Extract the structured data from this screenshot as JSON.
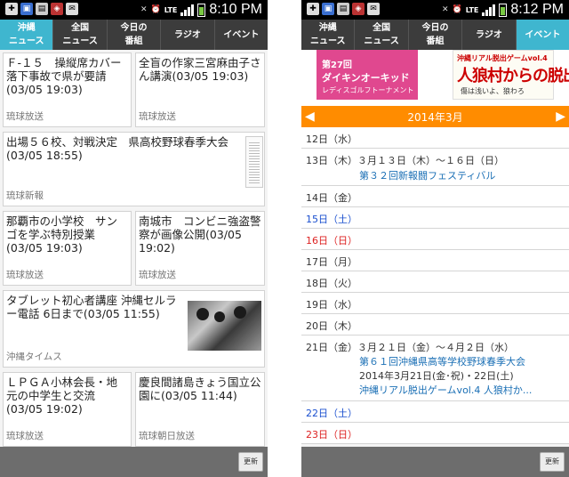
{
  "left": {
    "status": {
      "clock": "8:10 PM",
      "network": "LTE"
    },
    "tabs": [
      "沖縄\nニュース",
      "全国\nニュース",
      "今日の\n番組",
      "ラジオ",
      "イベント"
    ],
    "active_tab": 0,
    "articles": [
      {
        "title": "Ｆ-１５　操縦席カバー落下事故で県が要請(03/05 19:03)",
        "source": "琉球放送"
      },
      {
        "title": "全盲の作家三宮麻由子さん講演(03/05 19:03)",
        "source": "琉球放送"
      },
      {
        "title": "出場５６校、対戦決定　県高校野球春季大会(03/05 18:55)",
        "source": "琉球新報"
      },
      {
        "title": "那覇市の小学校　サンゴを学ぶ特別授業(03/05 19:03)",
        "source": "琉球放送"
      },
      {
        "title": "南城市　コンビニ強盗警察が画像公開(03/05 19:02)",
        "source": "琉球放送"
      },
      {
        "title": "タブレット初心者講座 沖縄セルラー電話 6日まで(03/05 11:55)",
        "source": "沖縄タイムス"
      },
      {
        "title": "ＬＰＧＡ小林会長・地元の中学生と交流(03/05 19:02)",
        "source": "琉球放送"
      },
      {
        "title": "慶良間諸島きょう国立公園に(03/05 11:44)",
        "source": "琉球朝日放送"
      }
    ],
    "update_button": "更新"
  },
  "right": {
    "status": {
      "clock": "8:12 PM",
      "network": "LTE"
    },
    "tabs": [
      "沖縄\nニュース",
      "全国\nニュース",
      "今日の\n番組",
      "ラジオ",
      "イベント"
    ],
    "active_tab": 4,
    "banner1": {
      "line1": "第27回",
      "line2": "ダイキンオーキッド",
      "line3": "レディスゴルフトーナメント"
    },
    "banner2": {
      "line1": "沖縄リアル脱出ゲームvol.4",
      "line2": "人狼村からの脱出",
      "line3": "傷は浅いよ、狼わろ"
    },
    "month": {
      "label": "2014年3月",
      "prev": "◀",
      "next": "▶"
    },
    "days": [
      {
        "head": "12日（水）",
        "type": "weekday",
        "events": []
      },
      {
        "head": "13日（木）３月１３日（木）～１６日（日）",
        "type": "weekday",
        "events": [
          {
            "text": "第３２回新報闘フェスティバル",
            "style": "link"
          }
        ]
      },
      {
        "head": "14日（金）",
        "type": "weekday",
        "events": []
      },
      {
        "head": "15日（土）",
        "type": "sat",
        "events": []
      },
      {
        "head": "16日（日）",
        "type": "sun",
        "events": []
      },
      {
        "head": "17日（月）",
        "type": "weekday",
        "events": []
      },
      {
        "head": "18日（火）",
        "type": "weekday",
        "events": []
      },
      {
        "head": "19日（水）",
        "type": "weekday",
        "events": []
      },
      {
        "head": "20日（木）",
        "type": "weekday",
        "events": []
      },
      {
        "head": "21日（金）３月２１日（金）～４月２日（水）",
        "type": "weekday",
        "events": [
          {
            "text": "第６１回沖縄県高等学校野球春季大会",
            "style": "link"
          },
          {
            "text": "2014年3月21日(金･祝)・22日(土)",
            "style": "plain"
          },
          {
            "text": "沖縄リアル脱出ゲームvol.4 人狼村か...",
            "style": "link"
          }
        ]
      },
      {
        "head": "22日（土）",
        "type": "sat",
        "events": []
      },
      {
        "head": "23日（日）",
        "type": "sun",
        "events": []
      }
    ],
    "update_button": "更新"
  },
  "colors": {
    "active_tab": "#3fb6cf",
    "tab_bg": "#3c3c3c",
    "month_bar": "#ff8c00",
    "link": "#1a6fb5"
  }
}
